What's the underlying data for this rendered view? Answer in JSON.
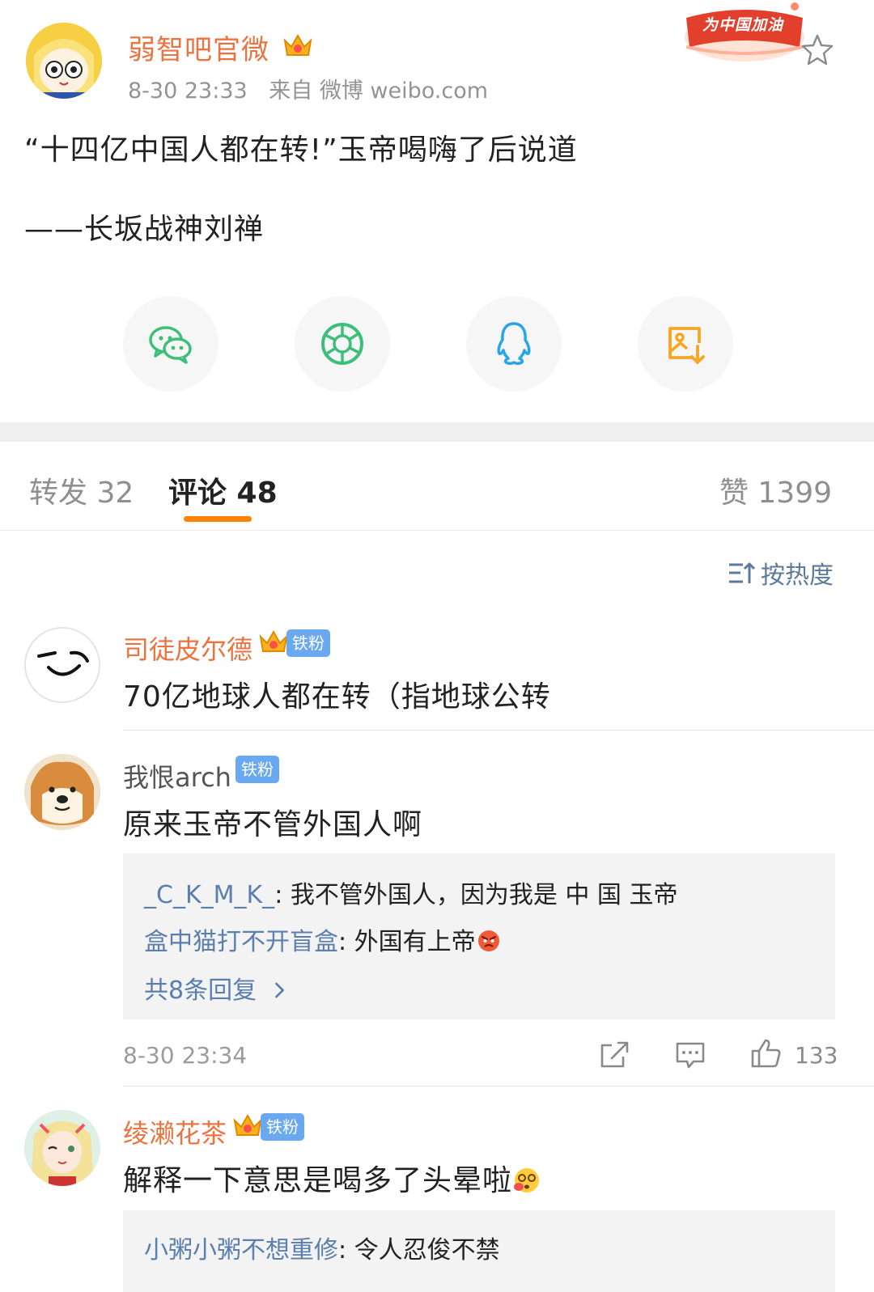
{
  "post": {
    "author": "弱智吧官微",
    "time": "8-30 23:33",
    "source": "来自 微博 weibo.com",
    "badge_text": "为中国加油",
    "lines": [
      "“十四亿中国人都在转!”玉帝喝嗨了后说道",
      "——长坂战神刘禅"
    ]
  },
  "share": {
    "icons": [
      "wechat-icon",
      "moments-icon",
      "qq-icon",
      "save-image-icon"
    ]
  },
  "tabs": {
    "repost": "转发 32",
    "comment": "评论 48",
    "like": "赞 1399"
  },
  "sort": {
    "label": "按热度"
  },
  "comments": [
    {
      "user": "司徒皮尔德",
      "badge": "铁粉",
      "text": "70亿地球人都在转（指地球公转"
    },
    {
      "user": "我恨arch",
      "badge": "铁粉",
      "text": "原来玉帝不管外国人啊",
      "replies": [
        {
          "user": "_C_K_M_K_",
          "sep": ": ",
          "text": "我不管外国人，因为我是 中 国 玉帝"
        },
        {
          "user": "盒中猫打不开盲盒",
          "sep": ": ",
          "text": "外国有上帝"
        }
      ],
      "more_replies": "共8条回复",
      "time": "8-30 23:34",
      "likes": "133"
    },
    {
      "user": "绫濑花茶",
      "badge": "铁粉",
      "text": "解释一下意思是喝多了头晕啦",
      "replies": [
        {
          "user": "小粥小粥不想重修",
          "sep": ": ",
          "text": "令人忍俊不禁"
        }
      ]
    }
  ],
  "colors": {
    "vip_name": "#eb7340",
    "link_blue": "#5a7fae",
    "accent_orange": "#ff8200",
    "fan_badge": "#6aa9f0"
  }
}
